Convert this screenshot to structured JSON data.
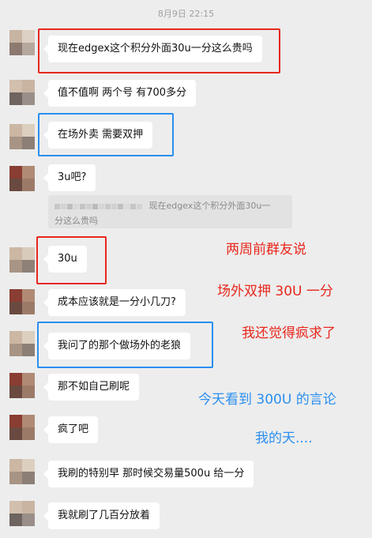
{
  "timestamp": "8月9日 22:15",
  "messages": [
    {
      "text": "现在edgex这个积分外面30u一分这么贵吗"
    },
    {
      "text": "值不值啊  两个号 有700多分"
    },
    {
      "text": "在场外卖  需要双押"
    },
    {
      "text": "3u吧?"
    },
    {
      "text": "30u"
    },
    {
      "text": "成本应该就是一分小几刀?"
    },
    {
      "text": "我问了的那个做场外的老狼"
    },
    {
      "text": "那不如自己刷呢"
    },
    {
      "text": "疯了吧"
    },
    {
      "text": "我刷的特别早  那时候交易量500u 给一分"
    },
    {
      "text": "我就刷了几百分放着"
    }
  ],
  "quote": {
    "line1": "现在edgex这个积分外面30u一",
    "line2": "分这么贵吗"
  },
  "annotations": [
    {
      "text": "两周前群友说",
      "color": "#e8271c"
    },
    {
      "text": "场外双押 30U 一分",
      "color": "#e8271c"
    },
    {
      "text": "我还觉得疯求了",
      "color": "#e8271c"
    },
    {
      "text": "今天看到 300U 的言论",
      "color": "#2a8ff0"
    },
    {
      "text": "我的天....",
      "color": "#2a8ff0"
    }
  ],
  "highlight_colors": {
    "red": "#e8271c",
    "blue": "#2a8ff0"
  }
}
